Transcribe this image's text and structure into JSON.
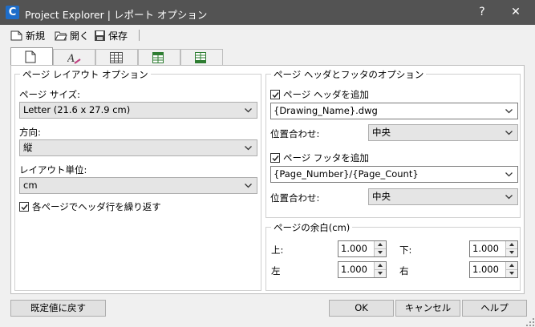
{
  "window": {
    "title": "Project Explorer | レポート オプション",
    "help_glyph": "?",
    "close_glyph": "✕"
  },
  "toolbar": {
    "new_label": "新規",
    "open_label": "開く",
    "save_label": "保存"
  },
  "tabs": [
    {
      "icon": "page-icon",
      "active": true
    },
    {
      "icon": "text-style-icon"
    },
    {
      "icon": "table-icon"
    },
    {
      "icon": "table-header-icon"
    },
    {
      "icon": "table-footer-icon"
    }
  ],
  "page_layout": {
    "title": "ページ レイアウト オプション",
    "page_size_label": "ページ サイズ:",
    "page_size_value": "Letter (21.6 x 27.9 cm)",
    "orientation_label": "方向:",
    "orientation_value": "縦",
    "units_label": "レイアウト単位:",
    "units_value": "cm",
    "repeat_header_label": "各ページでヘッダ行を繰り返す",
    "repeat_header_checked": true
  },
  "header_footer": {
    "title": "ページ ヘッダとフッタのオプション",
    "add_header_label": "ページ ヘッダを追加",
    "add_header_checked": true,
    "header_value": "{Drawing_Name}.dwg",
    "header_align_label": "位置合わせ:",
    "header_align_value": "中央",
    "add_footer_label": "ページ フッタを追加",
    "add_footer_checked": true,
    "footer_value": "{Page_Number}/{Page_Count}",
    "footer_align_label": "位置合わせ:",
    "footer_align_value": "中央"
  },
  "margins": {
    "title": "ページの余白(cm)",
    "top_label": "上:",
    "top_value": "1.000",
    "bottom_label": "下:",
    "bottom_value": "1.000",
    "left_label": "左",
    "left_value": "1.000",
    "right_label": "右",
    "right_value": "1.000"
  },
  "buttons": {
    "reset": "既定値に戻す",
    "ok": "OK",
    "cancel": "キャンセル",
    "help": "ヘルプ"
  }
}
